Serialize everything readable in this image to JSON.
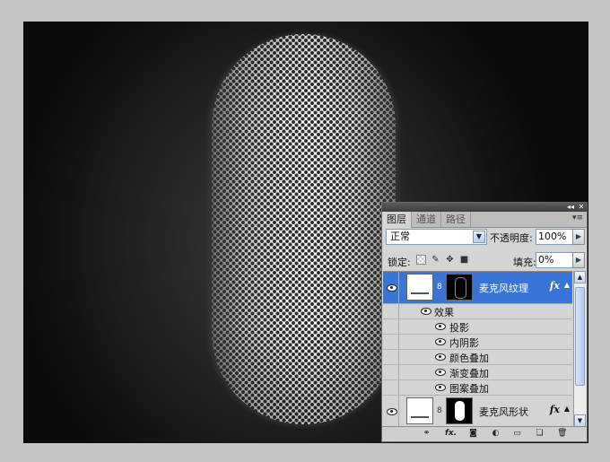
{
  "panel": {
    "tabs": [
      {
        "label": "图层"
      },
      {
        "label": "通道"
      },
      {
        "label": "路径"
      }
    ],
    "blend_mode": "正常",
    "opacity_label": "不透明度:",
    "opacity_value": "100%",
    "lock_label": "锁定:",
    "fill_label": "填充:",
    "fill_value": "0%",
    "layers": [
      {
        "name": "麦克风纹理",
        "fx": "fx",
        "selected": true
      },
      {
        "name": "麦克风形状",
        "fx": "fx",
        "selected": false
      }
    ],
    "effects_label": "效果",
    "effects": [
      {
        "name": "投影"
      },
      {
        "name": "内阴影"
      },
      {
        "name": "颜色叠加"
      },
      {
        "name": "渐变叠加"
      },
      {
        "name": "图案叠加"
      }
    ],
    "bottom_icons": [
      "link-icon",
      "fx-icon",
      "mask-icon",
      "adjustment-icon",
      "folder-icon",
      "new-layer-icon",
      "trash-icon"
    ]
  },
  "colors": {
    "selection": "#3875d7",
    "panel_bg": "#d4d4d4",
    "workspace_bg": "#c5c5c5"
  }
}
